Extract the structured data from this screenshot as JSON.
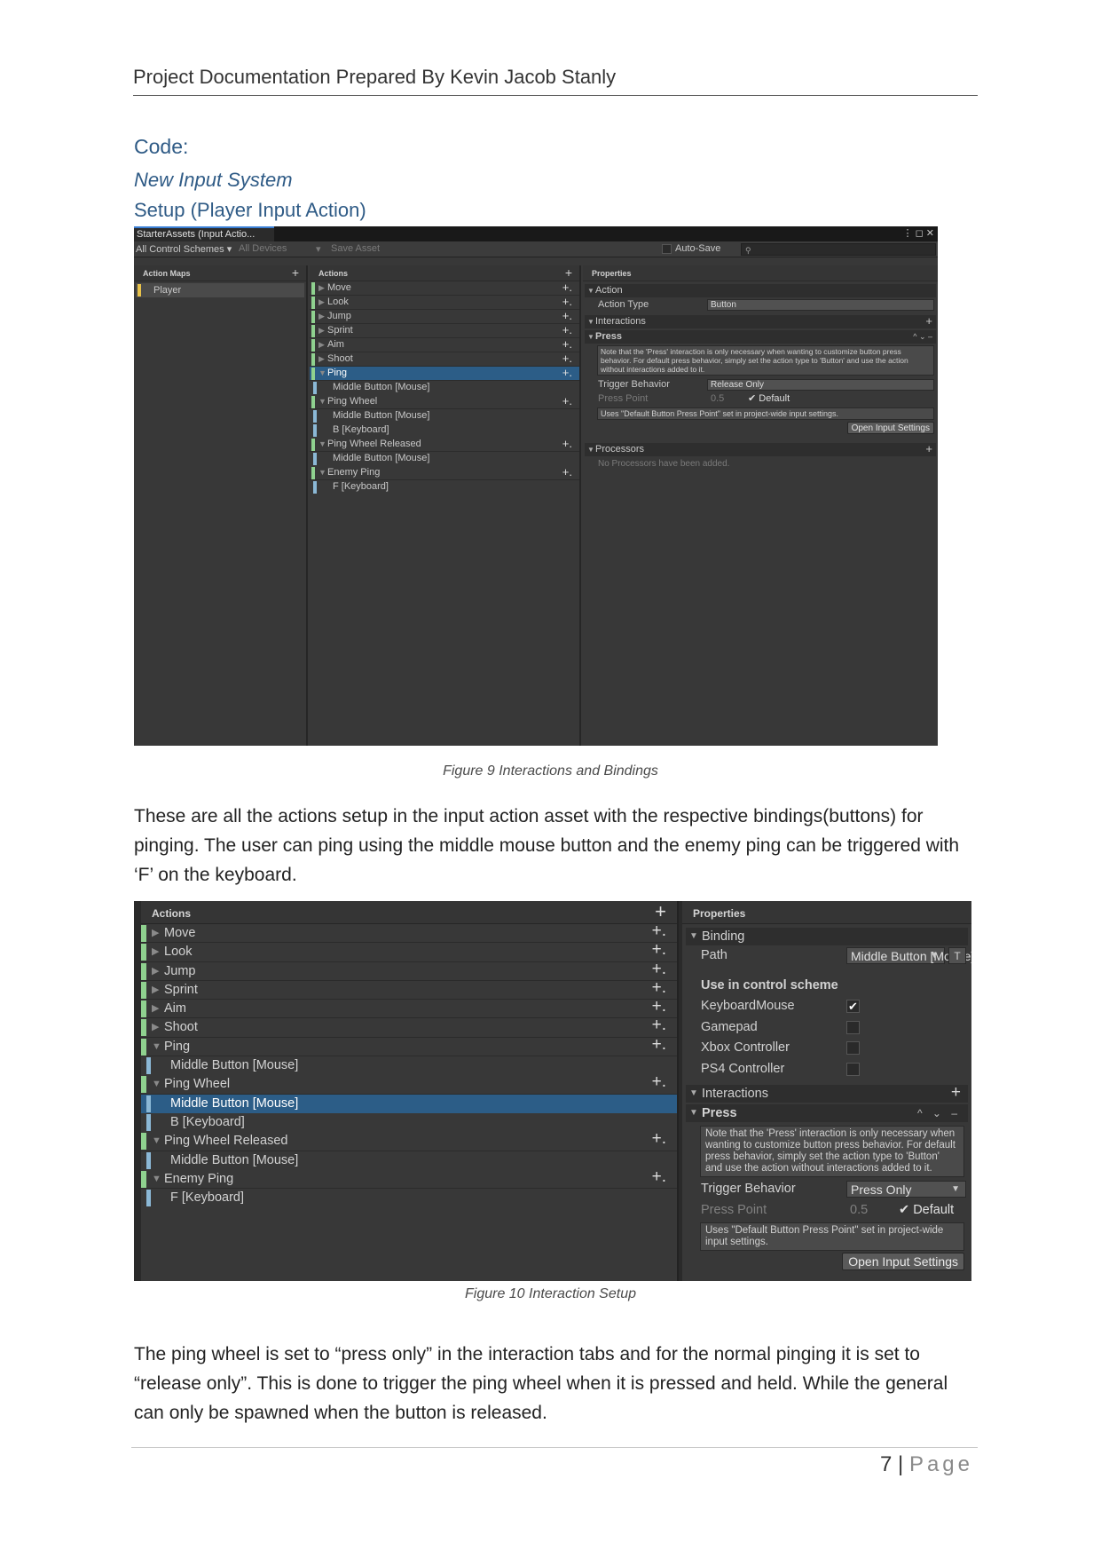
{
  "header": {
    "title": "Project Documentation Prepared By Kevin Jacob Stanly"
  },
  "headings": {
    "code": "Code:",
    "subtitle": "New Input System",
    "setup": "Setup (Player Input Action)"
  },
  "figure1": {
    "tab_title": "StarterAssets (Input Actio...",
    "window_controls": "⋮ ◻ ✕",
    "toolbar": {
      "control_schemes": "All Control Schemes ▾",
      "devices": "All Devices",
      "devices_arrow": "▾",
      "save": "Save Asset",
      "autosave": "Auto-Save",
      "search_icon": "⚲"
    },
    "action_maps_header": "Action Maps",
    "action_maps": [
      "Player"
    ],
    "actions_header": "Actions",
    "properties_header": "Properties",
    "rows": [
      {
        "label": "Move",
        "type": "action",
        "tri": "▶"
      },
      {
        "label": "Look",
        "type": "action",
        "tri": "▶"
      },
      {
        "label": "Jump",
        "type": "action",
        "tri": "▶"
      },
      {
        "label": "Sprint",
        "type": "action",
        "tri": "▶"
      },
      {
        "label": "Aim",
        "type": "action",
        "tri": "▶"
      },
      {
        "label": "Shoot",
        "type": "action",
        "tri": "▶"
      },
      {
        "label": "Ping",
        "type": "action",
        "tri": "▼",
        "selected": true
      },
      {
        "label": "Middle Button [Mouse]",
        "type": "binding"
      },
      {
        "label": "Ping Wheel",
        "type": "action",
        "tri": "▼"
      },
      {
        "label": "Middle Button [Mouse]",
        "type": "binding"
      },
      {
        "label": "B [Keyboard]",
        "type": "binding"
      },
      {
        "label": "Ping Wheel Released",
        "type": "action",
        "tri": "▼"
      },
      {
        "label": "Middle Button [Mouse]",
        "type": "binding"
      },
      {
        "label": "Enemy Ping",
        "type": "action",
        "tri": "▼"
      },
      {
        "label": "F [Keyboard]",
        "type": "binding"
      }
    ],
    "props": {
      "action_section": "Action",
      "action_type_label": "Action Type",
      "action_type_value": "Button",
      "interactions_section": "Interactions",
      "press_section": "Press",
      "press_controls": "^ ⌄ –",
      "note": "Note that the 'Press' interaction is only necessary when wanting to customize button press behavior. For default press behavior, simply set the action type to 'Button' and use the action without interactions added to it.",
      "trigger_label": "Trigger Behavior",
      "trigger_value": "Release Only",
      "press_point_label": "Press Point",
      "press_point_value": "0.5",
      "default_label": "Default",
      "uses_default": "Uses \"Default Button Press Point\" set in project-wide input settings.",
      "open_settings": "Open Input Settings",
      "processors_section": "Processors",
      "no_processors": "No Processors have been added."
    },
    "caption": "Figure 9 Interactions and Bindings"
  },
  "para1": "These are all the actions setup in the input action asset with the respective bindings(buttons) for pinging. The user can ping using the middle mouse button and the enemy ping can be triggered with ‘F’ on the keyboard.",
  "figure2": {
    "actions_header": "Actions",
    "properties_header": "Properties",
    "rows": [
      {
        "label": "Move",
        "type": "action",
        "tri": "▶"
      },
      {
        "label": "Look",
        "type": "action",
        "tri": "▶"
      },
      {
        "label": "Jump",
        "type": "action",
        "tri": "▶"
      },
      {
        "label": "Sprint",
        "type": "action",
        "tri": "▶"
      },
      {
        "label": "Aim",
        "type": "action",
        "tri": "▶"
      },
      {
        "label": "Shoot",
        "type": "action",
        "tri": "▶"
      },
      {
        "label": "Ping",
        "type": "action",
        "tri": "▼"
      },
      {
        "label": "Middle Button [Mouse]",
        "type": "binding"
      },
      {
        "label": "Ping Wheel",
        "type": "action",
        "tri": "▼"
      },
      {
        "label": "Middle Button [Mouse]",
        "type": "binding",
        "selected": true
      },
      {
        "label": "B [Keyboard]",
        "type": "binding"
      },
      {
        "label": "Ping Wheel Released",
        "type": "action",
        "tri": "▼"
      },
      {
        "label": "Middle Button [Mouse]",
        "type": "binding"
      },
      {
        "label": "Enemy Ping",
        "type": "action",
        "tri": "▼"
      },
      {
        "label": "F [Keyboard]",
        "type": "binding"
      }
    ],
    "props": {
      "binding_section": "Binding",
      "path_label": "Path",
      "path_value": "Middle Button [Mouse]",
      "path_t": "T",
      "control_scheme_label": "Use in control scheme",
      "schemes": [
        {
          "label": "KeyboardMouse",
          "checked": true
        },
        {
          "label": "Gamepad",
          "checked": false
        },
        {
          "label": "Xbox Controller",
          "checked": false
        },
        {
          "label": "PS4 Controller",
          "checked": false
        }
      ],
      "interactions_section": "Interactions",
      "press_section": "Press",
      "press_controls": "^ ⌄ –",
      "note": "Note that the 'Press' interaction is only necessary when wanting to customize button press behavior. For default press behavior, simply set the action type to 'Button' and use the action without interactions added to it.",
      "trigger_label": "Trigger Behavior",
      "trigger_value": "Press Only",
      "press_point_label": "Press Point",
      "press_point_value": "0.5",
      "default_label": "Default",
      "uses_default": "Uses \"Default Button Press Point\" set in project-wide input settings.",
      "open_settings": "Open Input Settings"
    },
    "caption": "Figure 10 Interaction Setup"
  },
  "para2": "The ping wheel is set to “press only” in the interaction tabs and for the normal pinging it is set to “release only”. This is done to trigger the ping wheel when it is pressed and held. While the general can only be spawned when the button is released.",
  "footer": {
    "page_number": "7",
    "separator": "|",
    "page_word": "Page"
  }
}
